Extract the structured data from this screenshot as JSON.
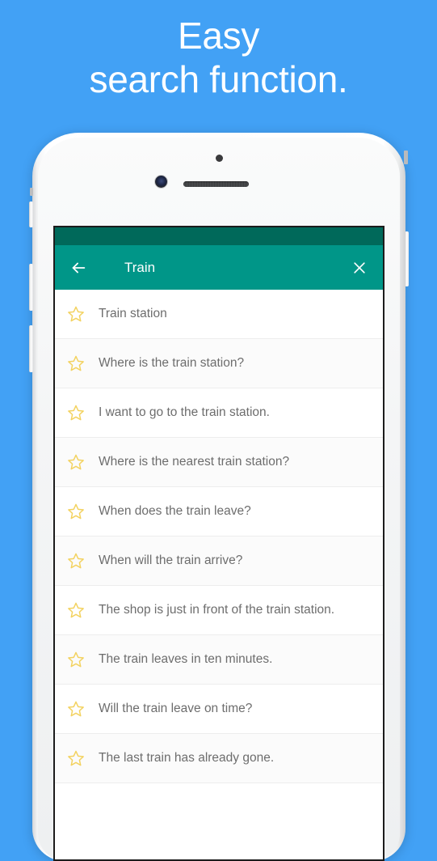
{
  "headline": "Easy\nsearch function.",
  "colors": {
    "background_blue": "#42a1f5",
    "toolbar_teal": "#009688",
    "status_bar_teal": "#00695a",
    "star_yellow": "#f3d25f",
    "row_text_grey": "#6d6d6d"
  },
  "phone": {
    "hardware": {
      "silent_switch": "silent-switch",
      "volume_up": "volume-up-button",
      "volume_down": "volume-down-button",
      "power": "power-button",
      "camera": "front-camera",
      "sensor": "proximity-sensor",
      "speaker": "earpiece-speaker"
    }
  },
  "app": {
    "toolbar": {
      "back_icon": "back-arrow-icon",
      "title": "Train",
      "close_icon": "close-icon"
    },
    "list": {
      "favorite_icon": "star-outline-icon",
      "items": [
        {
          "text": "Train station"
        },
        {
          "text": "Where is the train station?"
        },
        {
          "text": "I want to go to the train station."
        },
        {
          "text": "Where is the nearest train station?"
        },
        {
          "text": "When does the train leave?"
        },
        {
          "text": "When will the train arrive?"
        },
        {
          "text": "The shop is just in front of the train station."
        },
        {
          "text": "The train leaves in ten minutes."
        },
        {
          "text": "Will the train leave on time?"
        },
        {
          "text": "The last train has already gone."
        }
      ]
    }
  }
}
